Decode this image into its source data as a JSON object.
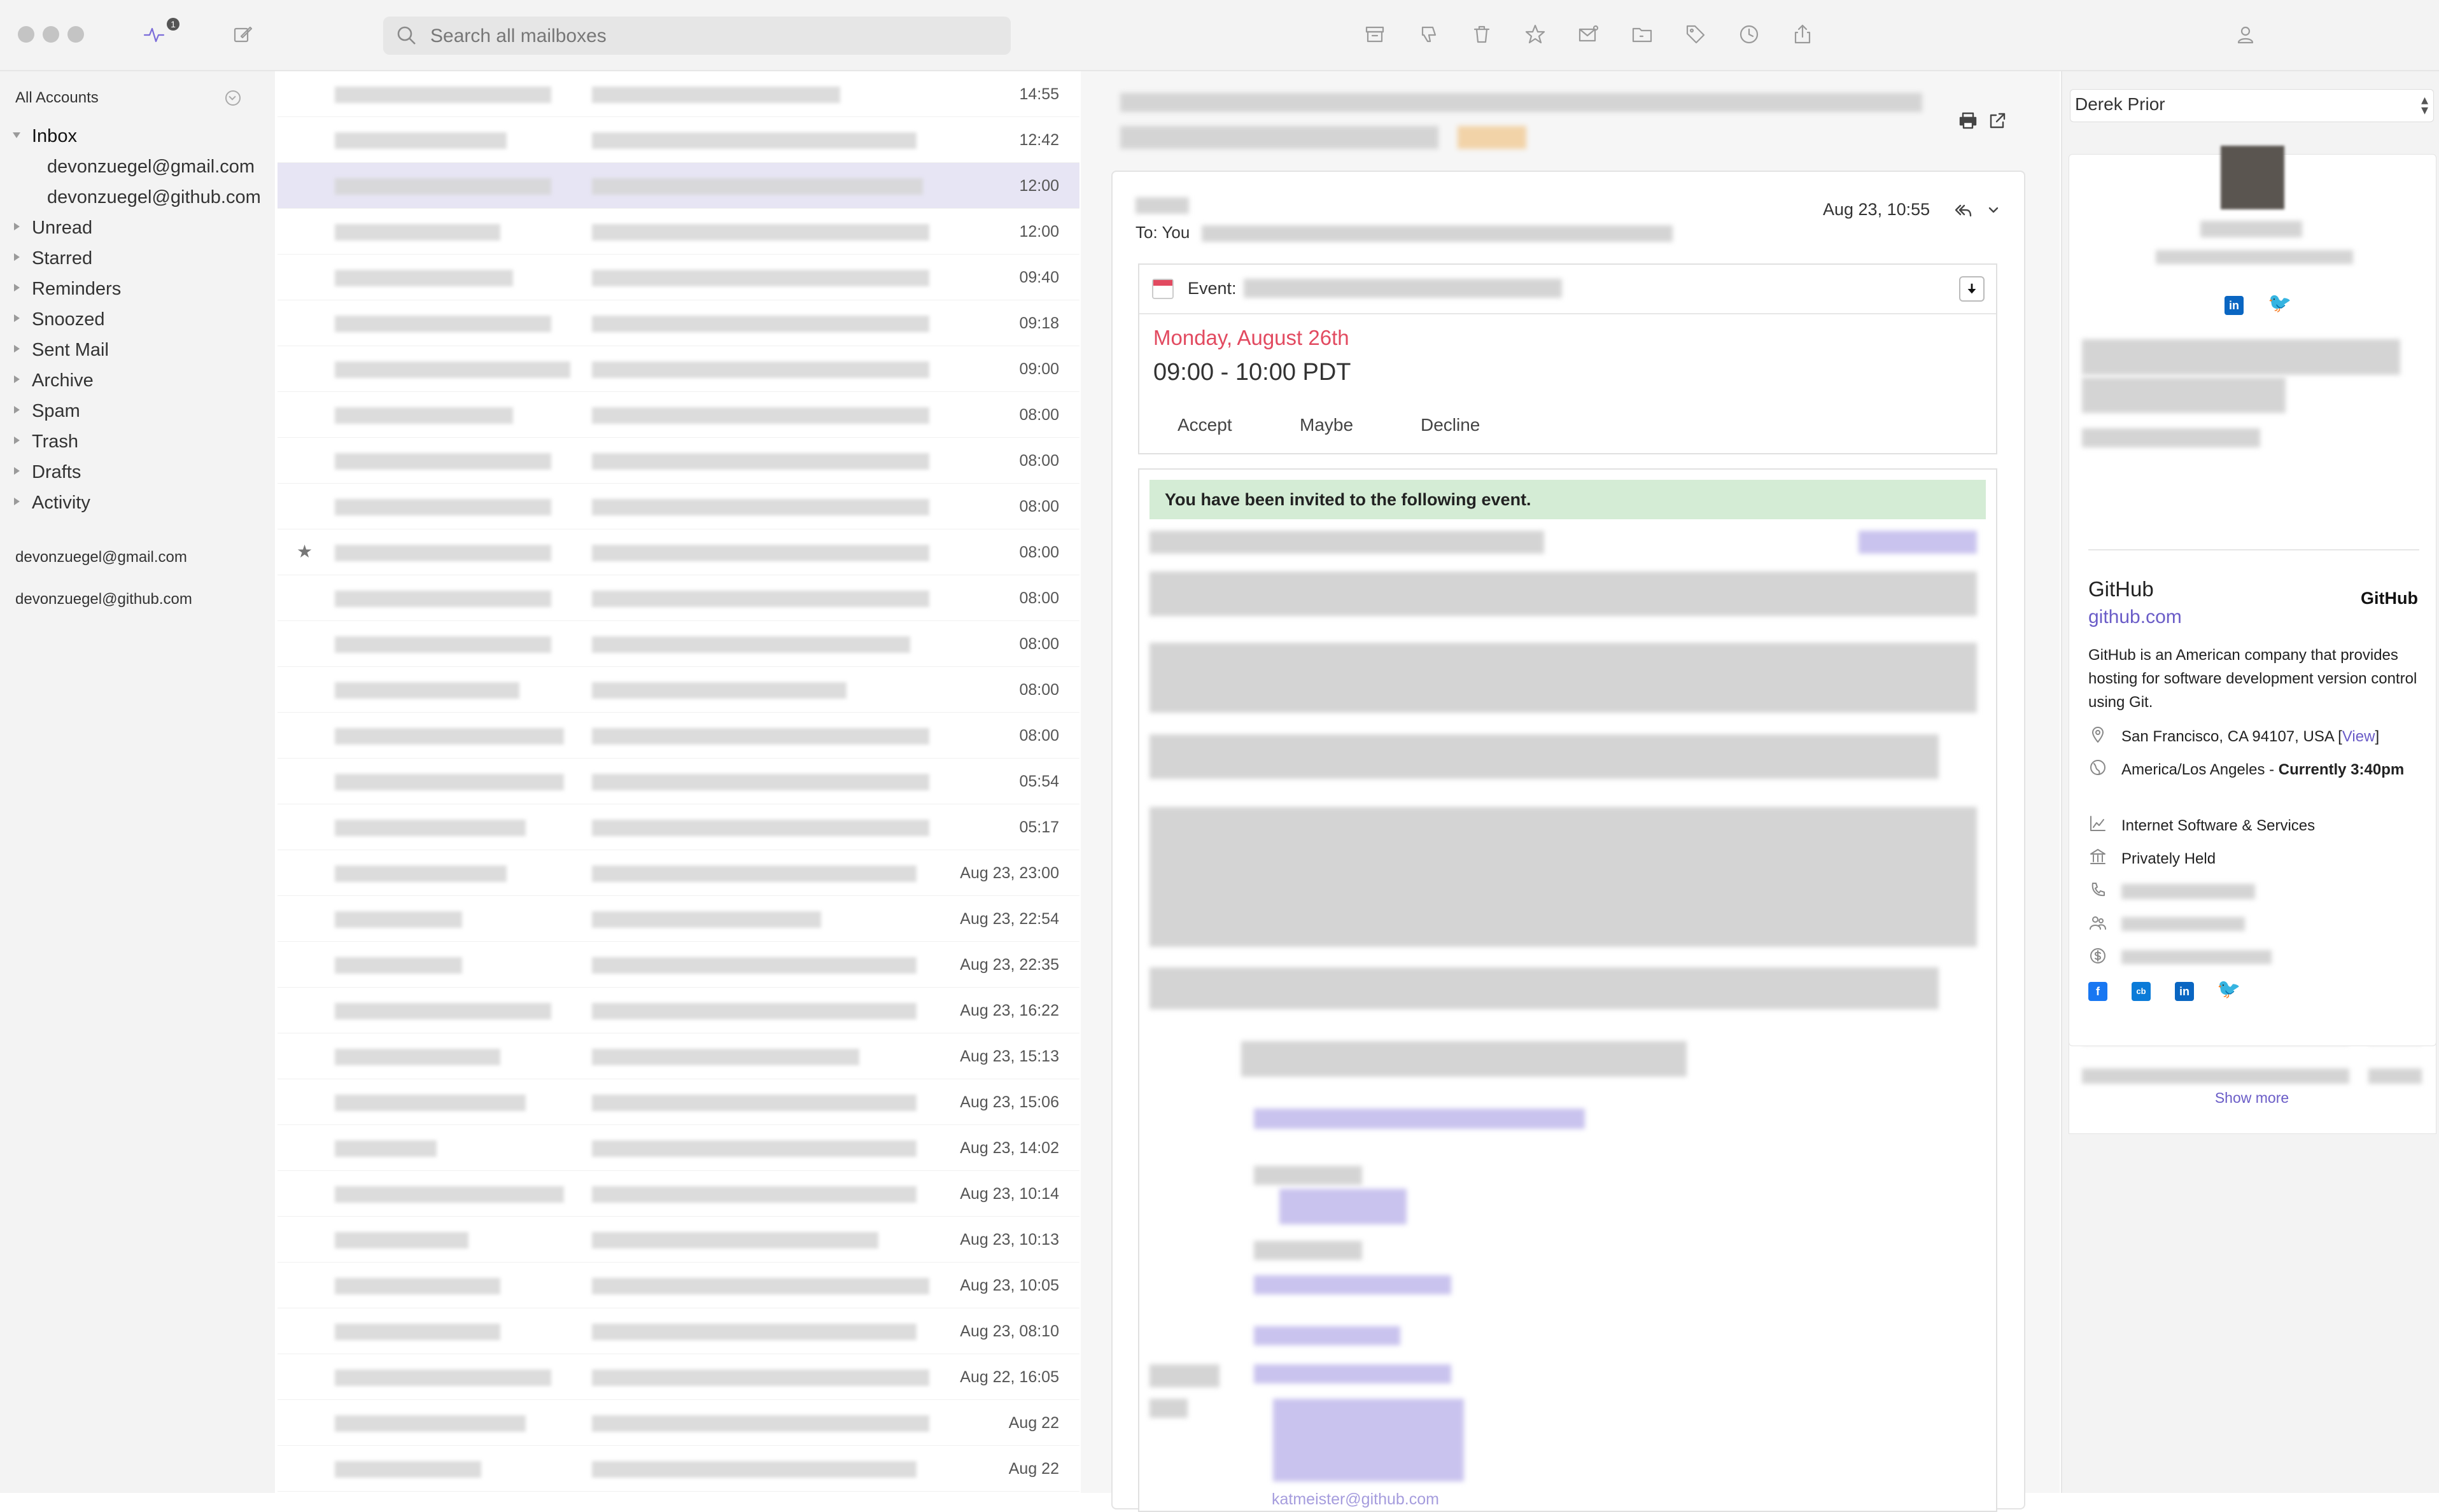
{
  "search": {
    "placeholder": "Search all mailboxes"
  },
  "activity": {
    "badge": "1"
  },
  "sidebar": {
    "all_accounts": "All Accounts",
    "inbox": "Inbox",
    "inbox_accounts": [
      "devonzuegel@gmail.com",
      "devonzuegel@github.com"
    ],
    "folders": [
      "Unread",
      "Starred",
      "Reminders",
      "Snoozed",
      "Sent Mail",
      "Archive",
      "Spam",
      "Trash",
      "Drafts",
      "Activity"
    ],
    "accounts": [
      "devonzuegel@gmail.com",
      "devonzuegel@github.com"
    ]
  },
  "messages": [
    {
      "time": "14:55"
    },
    {
      "time": "12:42"
    },
    {
      "time": "12:00",
      "selected": true
    },
    {
      "time": "12:00"
    },
    {
      "time": "09:40"
    },
    {
      "time": "09:18"
    },
    {
      "time": "09:00"
    },
    {
      "time": "08:00"
    },
    {
      "time": "08:00"
    },
    {
      "time": "08:00"
    },
    {
      "time": "08:00",
      "starred": true
    },
    {
      "time": "08:00"
    },
    {
      "time": "08:00"
    },
    {
      "time": "08:00"
    },
    {
      "time": "08:00"
    },
    {
      "time": "05:54"
    },
    {
      "time": "05:17"
    },
    {
      "time": "Aug 23, 23:00"
    },
    {
      "time": "Aug 23, 22:54"
    },
    {
      "time": "Aug 23, 22:35"
    },
    {
      "time": "Aug 23, 16:22"
    },
    {
      "time": "Aug 23, 15:13"
    },
    {
      "time": "Aug 23, 15:06"
    },
    {
      "time": "Aug 23, 14:02"
    },
    {
      "time": "Aug 23, 10:14"
    },
    {
      "time": "Aug 23, 10:13"
    },
    {
      "time": "Aug 23, 10:05"
    },
    {
      "time": "Aug 23, 08:10"
    },
    {
      "time": "Aug 22, 16:05"
    },
    {
      "time": "Aug 22"
    },
    {
      "time": "Aug 22"
    }
  ],
  "reading": {
    "date": "Aug 23, 10:55",
    "to": "To: You",
    "event_label": "Event:",
    "event_date": "Monday, August 26th",
    "event_time": "09:00 - 10:00 PDT",
    "rsvp": [
      "Accept",
      "Maybe",
      "Decline"
    ],
    "invited_banner": "You have been invited to the following event.",
    "email_fragment": "katmeister@github.com"
  },
  "contact": {
    "selected_name": "Derek Prior",
    "company": "GitHub",
    "company_logo": "GitHub",
    "company_link": "github.com",
    "description": "GitHub is an American company that provides hosting for software development version control using Git.",
    "location": "San Francisco, CA 94107, USA",
    "view_link": "View",
    "timezone": "America/Los Angeles - ",
    "timezone_bold": "Currently 3:40pm",
    "industry": "Internet Software & Services",
    "ownership": "Privately Held",
    "show_more": "Show more"
  },
  "colors": {
    "accent": "#6a5cc7",
    "event_red": "#e24a60",
    "banner_green": "#d4ecd5",
    "selected_row": "#e7e5f4"
  }
}
